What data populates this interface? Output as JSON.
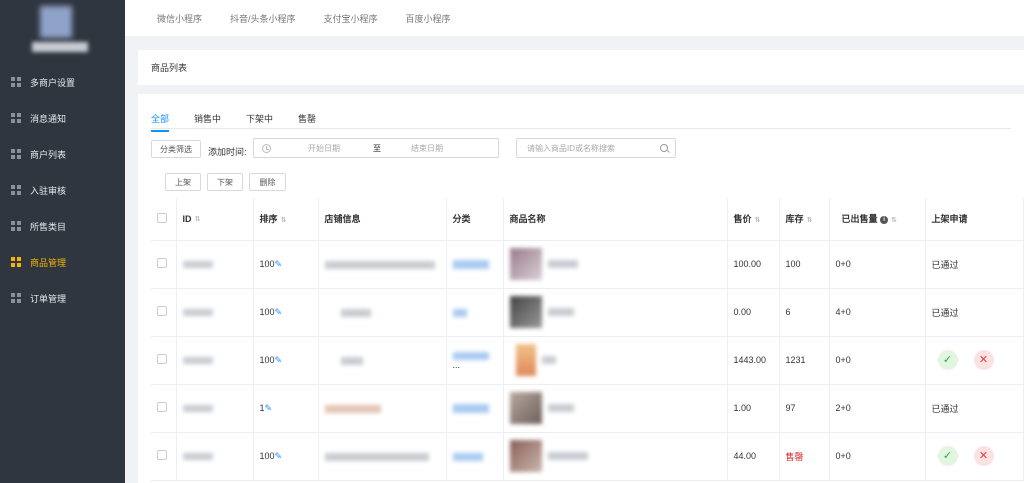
{
  "sidebar": {
    "items": [
      {
        "label": "多商户设置",
        "active": false
      },
      {
        "label": "消息通知",
        "active": false
      },
      {
        "label": "商户列表",
        "active": false
      },
      {
        "label": "入驻审核",
        "active": false
      },
      {
        "label": "所售类目",
        "active": false
      },
      {
        "label": "商品管理",
        "active": true
      },
      {
        "label": "订单管理",
        "active": false
      }
    ]
  },
  "topnav": [
    "微信小程序",
    "抖音/头条小程序",
    "支付宝小程序",
    "百度小程序"
  ],
  "page_title": "商品列表",
  "tabs": [
    "全部",
    "销售中",
    "下架中",
    "售罄"
  ],
  "filters": {
    "category_button": "分类筛选",
    "add_time_label": "添加时间:",
    "start_placeholder": "开始日期",
    "range_sep": "至",
    "end_placeholder": "结束日期",
    "search_placeholder": "请输入商品ID或名称搜索"
  },
  "actions": {
    "up": "上架",
    "down": "下架",
    "delete": "删除"
  },
  "table": {
    "headers": {
      "id": "ID",
      "sort": "排序",
      "store": "店铺信息",
      "category": "分类",
      "name": "商品名称",
      "price": "售价",
      "stock": "库存",
      "sold": "已出售量",
      "apply": "上架申请"
    },
    "rows": [
      {
        "sort": "100",
        "price": "100.00",
        "stock": "100",
        "sold": "0+0",
        "apply": "已通过",
        "stock_soldout": false
      },
      {
        "sort": "100",
        "price": "0.00",
        "stock": "6",
        "sold": "4+0",
        "apply": "已通过",
        "stock_soldout": false
      },
      {
        "sort": "100",
        "price": "1443.00",
        "stock": "1231",
        "sold": "0+0",
        "apply": "",
        "stock_soldout": false,
        "category_extra": "..."
      },
      {
        "sort": "1",
        "price": "1.00",
        "stock": "97",
        "sold": "2+0",
        "apply": "已通过",
        "stock_soldout": false
      },
      {
        "sort": "100",
        "price": "44.00",
        "stock": "售罄",
        "sold": "0+0",
        "apply": "",
        "stock_soldout": true
      }
    ]
  },
  "colors": {
    "sidebar_bg": "#2f3640",
    "active": "#f4b400",
    "primary": "#1890ff",
    "danger": "#e02020"
  }
}
